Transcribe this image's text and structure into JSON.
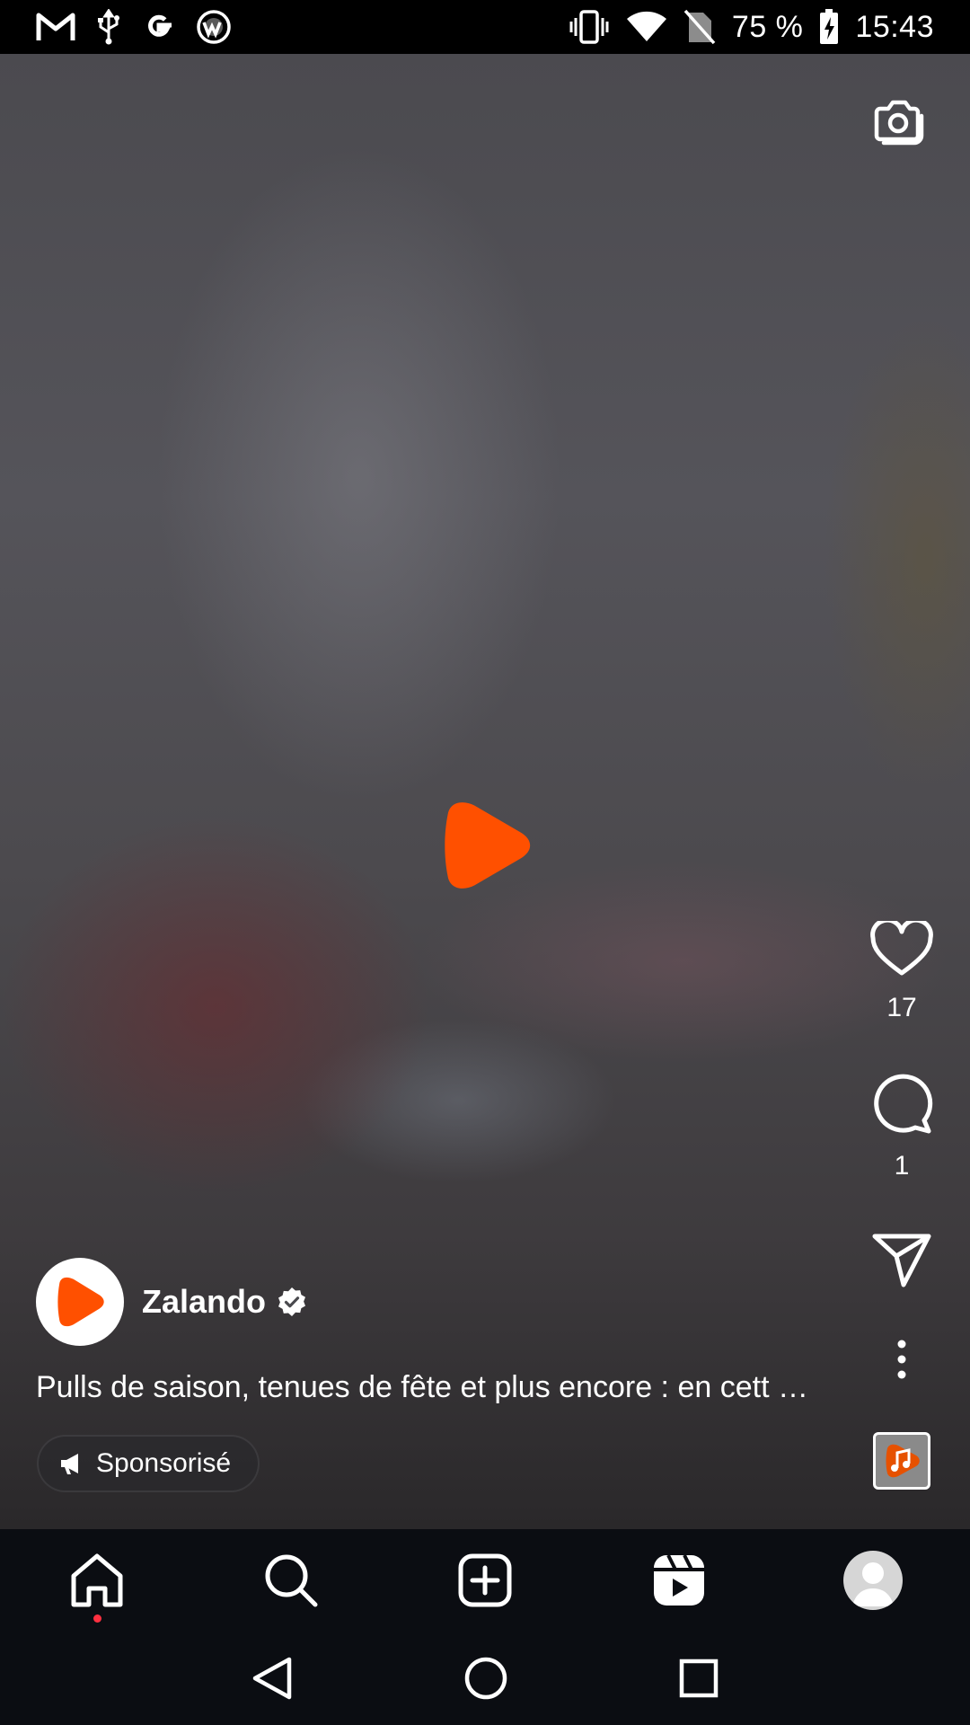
{
  "status_bar": {
    "icons_left": [
      "gmail-icon",
      "usb-icon",
      "google-icon",
      "vpn-icon"
    ],
    "icons_right": [
      "vibrate-icon",
      "wifi-icon",
      "no-sim-icon",
      "battery-charging-icon"
    ],
    "battery": "75 %",
    "time": "15:43"
  },
  "post": {
    "author": "Zalando",
    "verified": true,
    "caption": "Pulls de saison, tenues de fête et plus encore : en cett …",
    "sponsored_label": "Sponsorisé",
    "brand_color": "#FF4F00"
  },
  "actions": {
    "likes": "17",
    "comments": "1"
  },
  "bottom_nav": {
    "items": [
      "home-icon",
      "search-icon",
      "create-icon",
      "reels-icon",
      "profile-avatar"
    ],
    "active": "reels",
    "home_notification_dot": true
  },
  "system_nav": [
    "back-icon",
    "home-circle-icon",
    "recents-icon"
  ],
  "colors": {
    "background": "#000000",
    "nav_background": "#0B0D12",
    "notification_dot": "#FF3040"
  }
}
